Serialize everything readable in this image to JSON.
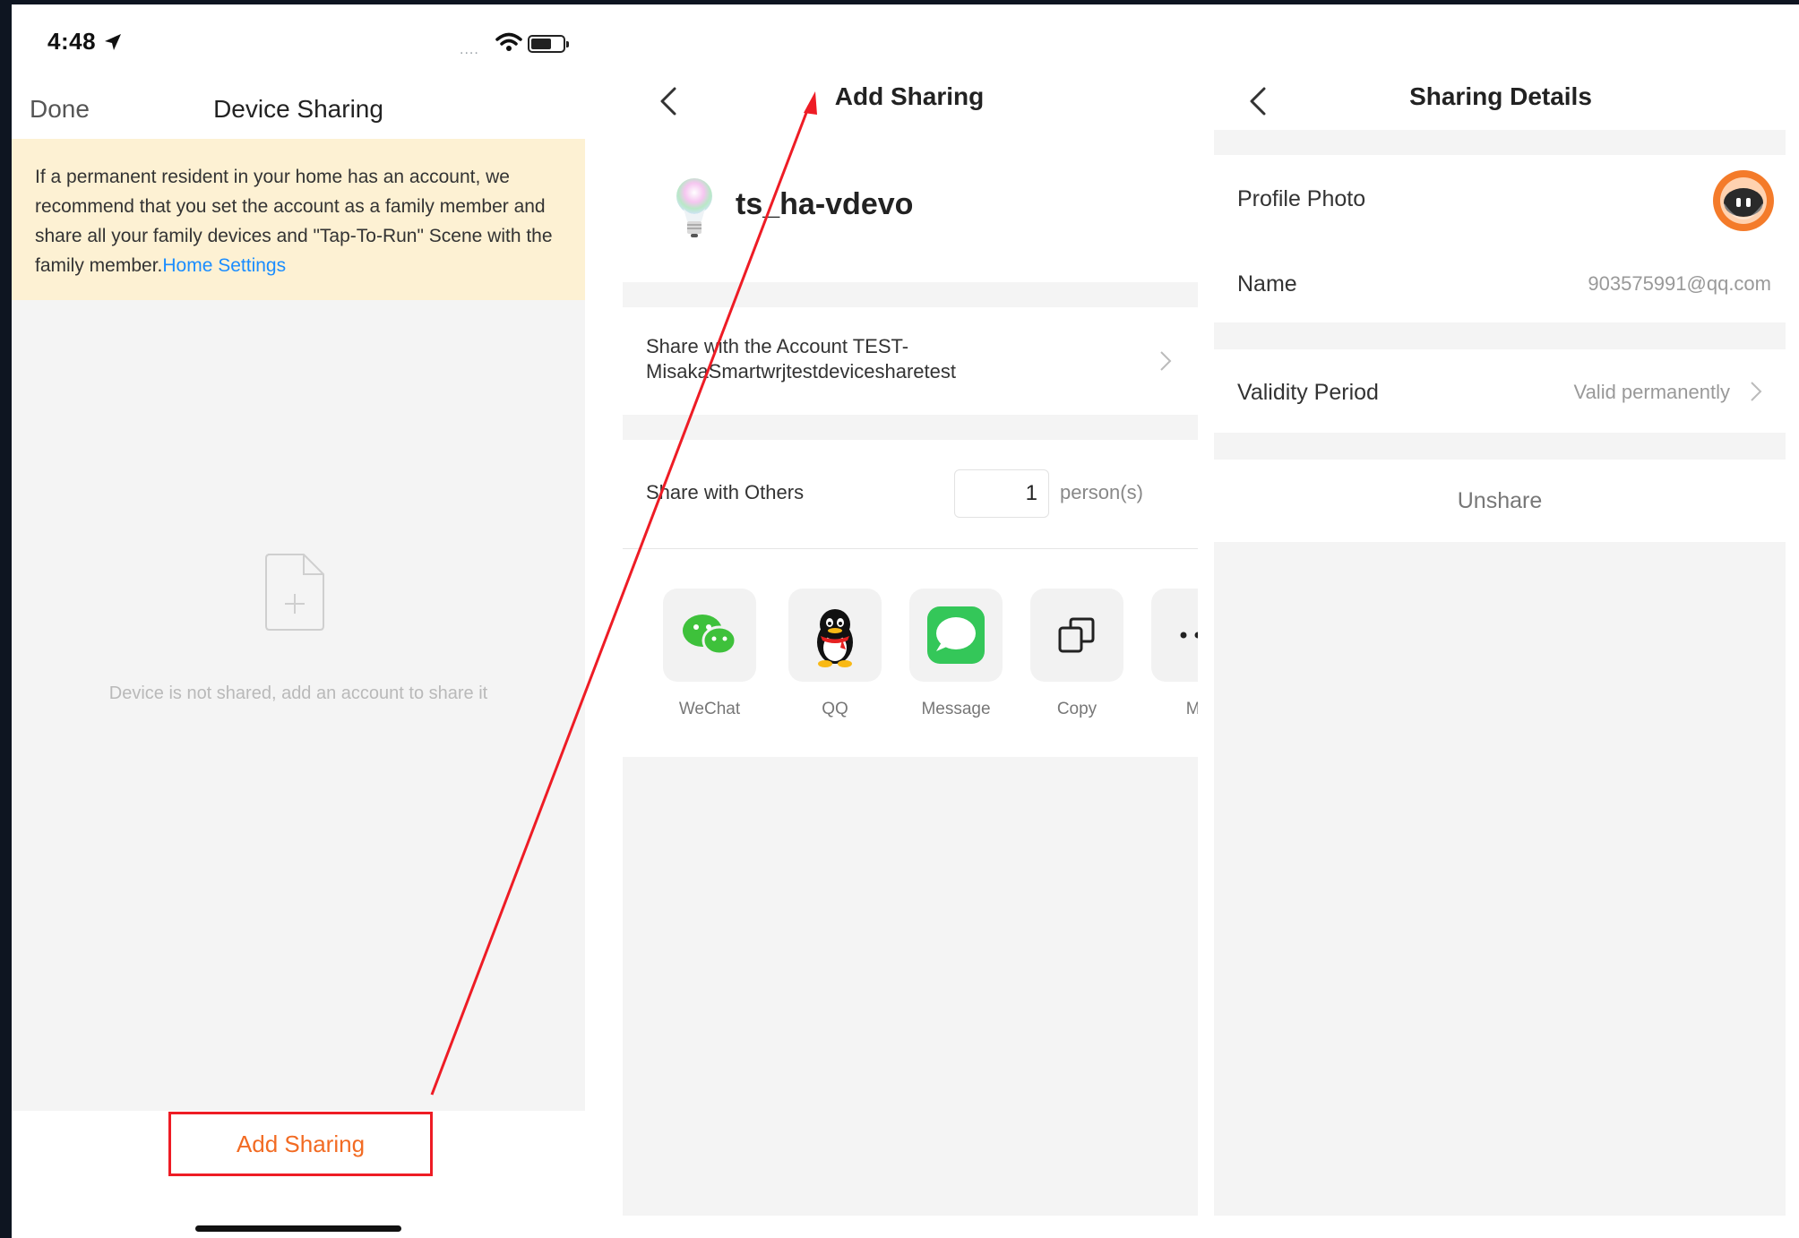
{
  "status_bar": {
    "time": "4:48",
    "signal": "....",
    "location-icon": "location-arrow-icon",
    "wifi-icon": "wifi-icon",
    "battery-icon": "battery-icon"
  },
  "device_sharing": {
    "done_label": "Done",
    "title": "Device Sharing",
    "notice_text": "If a permanent resident in your home has an account, we recommend that you set the account as a family member and share all your family devices and \"Tap-To-Run\" Scene with the family member.",
    "notice_link": "Home Settings",
    "empty_text": "Device is not shared, add an account to share it",
    "add_sharing_label": "Add Sharing",
    "empty_icon": "file-add-icon"
  },
  "add_sharing": {
    "title": "Add Sharing",
    "back_icon": "back-chevron-icon",
    "device_name": "ts_ha-vdevo",
    "device_icon": "bulb-icon",
    "share_account_line1": "Share with the Account TEST-",
    "share_account_line2": "MisakaSmartwrjtestdevicesharetest",
    "share_others_label": "Share with Others",
    "share_count": "1",
    "persons_label": "person(s)",
    "share_targets": [
      {
        "label": "WeChat",
        "icon": "wechat-icon"
      },
      {
        "label": "QQ",
        "icon": "qq-icon"
      },
      {
        "label": "Message",
        "icon": "message-icon"
      },
      {
        "label": "Copy",
        "icon": "copy-icon"
      },
      {
        "label": "Mo",
        "icon": "more-icon"
      }
    ]
  },
  "sharing_details": {
    "title": "Sharing Details",
    "back_icon": "back-chevron-icon",
    "profile_photo_label": "Profile Photo",
    "avatar_icon": "robot-avatar-icon",
    "name_label": "Name",
    "name_value": "903575991@qq.com",
    "validity_label": "Validity Period",
    "validity_value": "Valid permanently",
    "unshare_label": "Unshare"
  },
  "colors": {
    "accent_orange": "#f26b23",
    "annotation_red": "#ee1c25",
    "link_blue": "#1a8dff",
    "notice_bg": "#fdf1d3",
    "wechat_green": "#3ec13b",
    "message_green": "#34c759"
  }
}
